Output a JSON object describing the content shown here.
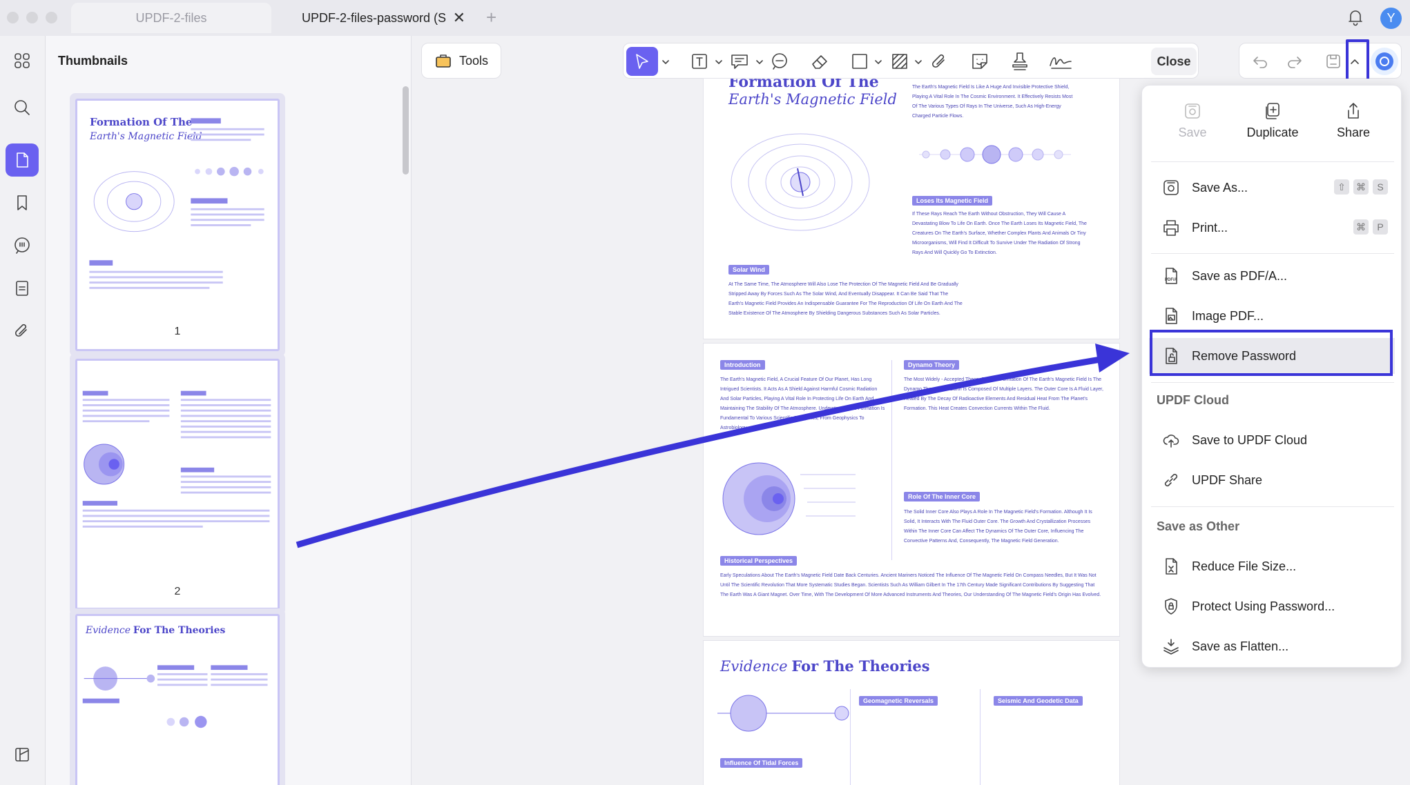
{
  "tabs": [
    {
      "label": "UPDF-2-files"
    },
    {
      "label": "UPDF-2-files-password (S"
    }
  ],
  "avatar_letter": "Y",
  "sidebar": {
    "title": "Thumbnails"
  },
  "thumbnails": [
    {
      "page": "1"
    },
    {
      "page": "2"
    }
  ],
  "toolbar": {
    "tools_label": "Tools",
    "close_label": "Close"
  },
  "document": {
    "page1": {
      "title_line1": "Formation Of The",
      "title_line2": "Earth's Magnetic Field",
      "text_right": "The Earth's Magnetic Field Is Like A Huge And Invisible Protective Shield, Playing A Vital Role In The Cosmic Environment. It Effectively Resists Most Of The Various Types Of Rays In The Universe, Such As High-Energy Charged Particle Flows.",
      "label_loses": "Loses Its Magnetic Field",
      "text_loses": "If These Rays Reach The Earth Without Obstruction, They Will Cause A Devastating Blow To Life On Earth. Once The Earth Loses Its Magnetic Field, The Creatures On The Earth's Surface, Whether Complex Plants And Animals Or Tiny Microorganisms, Will Find It Difficult To Survive Under The Radiation Of Strong Rays And Will Quickly Go To Extinction.",
      "label_solar": "Solar Wind",
      "text_solar": "At The Same Time, The Atmosphere Will Also Lose The Protection Of The Magnetic Field And Be Gradually Stripped Away By Forces Such As The Solar Wind, And Eventually Disappear. It Can Be Said That The Earth's Magnetic Field Provides An Indispensable Guarantee For The Reproduction Of Life On Earth And The Stable Existence Of The Atmosphere By Shielding Dangerous Substances Such As Solar Particles."
    },
    "page2": {
      "label_intro": "Introduction",
      "text_intro": "The Earth's Magnetic Field, A Crucial Feature Of Our Planet, Has Long Intrigued Scientists. It Acts As A Shield Against Harmful Cosmic Radiation And Solar Particles, Playing A Vital Role In Protecting Life On Earth And Maintaining The Stability Of The Atmosphere. Understanding Its Formation Is Fundamental To Various Scientific Disciplines, From Geophysics To Astrobiology.",
      "label_dynamo": "Dynamo Theory",
      "text_dynamo": "The Most Widely - Accepted Theory For The Formation Of The Earth's Magnetic Field Is The Dynamo Theory. The Earth Is Composed Of Multiple Layers. The Outer Core Is A Fluid Layer, Heated By The Decay Of Radioactive Elements And Residual Heat From The Planet's Formation. This Heat Creates Convection Currents Within The Fluid.",
      "label_inner": "Role Of The Inner Core",
      "text_inner": "The Solid Inner Core Also Plays A Role In The Magnetic Field's Formation. Although It Is Solid, It Interacts With The Fluid Outer Core. The Growth And Crystallization Processes Within The Inner Core Can Affect The Dynamics Of The Outer Core, Influencing The Convective Patterns And, Consequently, The Magnetic Field Generation.",
      "label_hist": "Historical Perspectives",
      "text_hist": "Early Speculations About The Earth's Magnetic Field Date Back Centuries. Ancient Mariners Noticed The Influence Of The Magnetic Field On Compass Needles, But It Was Not Until The Scientific Revolution That More Systematic Studies Began. Scientists Such As William Gilbert In The 17th Century Made Significant Contributions By Suggesting That The Earth Was A Giant Magnet. Over Time, With The Development Of More Advanced Instruments And Theories, Our Understanding Of The Magnetic Field's Origin Has Evolved."
    },
    "page3": {
      "title_italic": "Evidence",
      "title_bold": "For The Theories",
      "label_geo": "Geomagnetic Reversals",
      "label_seismic": "Seismic And Geodetic Data",
      "label_tidal": "Influence Of Tidal Forces"
    }
  },
  "menu": {
    "top": [
      {
        "label": "Save",
        "icon": "save-icon",
        "disabled": true
      },
      {
        "label": "Duplicate",
        "icon": "duplicate-icon"
      },
      {
        "label": "Share",
        "icon": "share-icon"
      }
    ],
    "save_as": "Save As...",
    "save_as_keys": [
      "⇧",
      "⌘",
      "S"
    ],
    "print": "Print...",
    "print_keys": [
      "⌘",
      "P"
    ],
    "save_pdfa": "Save as PDF/A...",
    "image_pdf": "Image PDF...",
    "remove_password": "Remove Password",
    "section_cloud": "UPDF Cloud",
    "save_cloud": "Save to UPDF Cloud",
    "updf_share": "UPDF Share",
    "section_other": "Save as Other",
    "reduce": "Reduce File Size...",
    "protect": "Protect Using Password...",
    "flatten": "Save as Flatten..."
  },
  "colors": {
    "accent": "#6a61f0",
    "highlight": "#3a34d8",
    "doc_text": "#4c46c9"
  }
}
